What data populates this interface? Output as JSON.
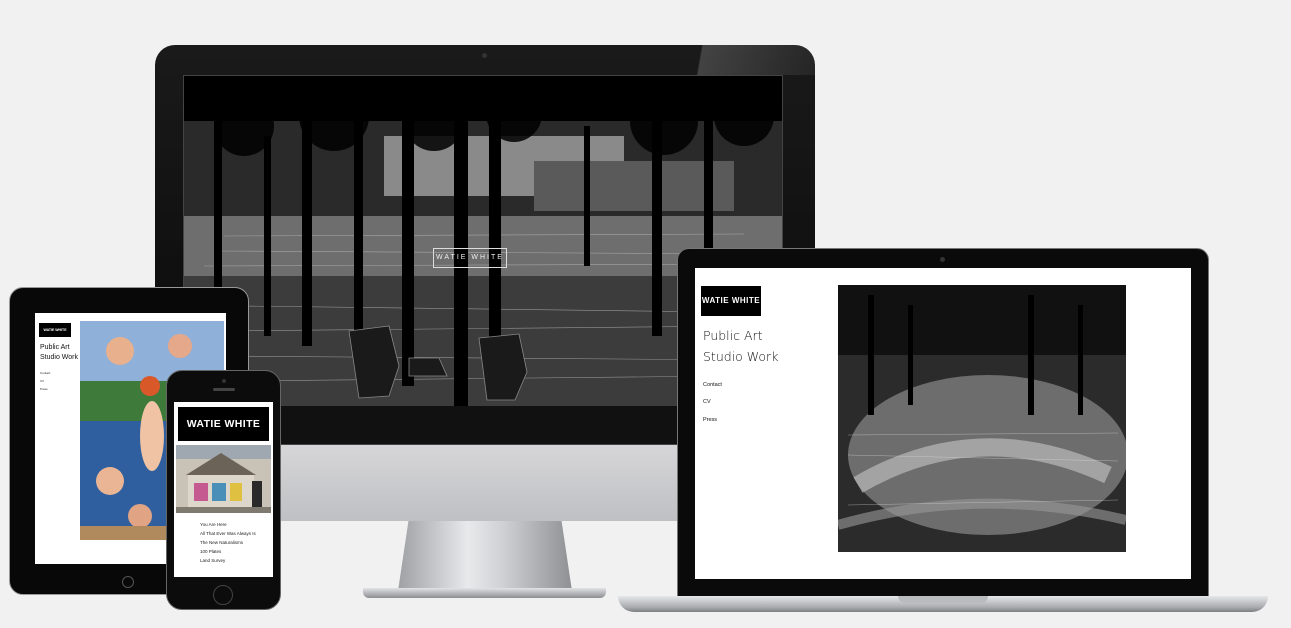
{
  "site": {
    "logo": "WATIE WHITE",
    "hero_logo": "WATIE WHITE"
  },
  "laptop": {
    "nav_primary": [
      "Public Art",
      "Studio Work"
    ],
    "nav_secondary": [
      "Contact",
      "CV",
      "Press"
    ]
  },
  "ipad": {
    "logo": "WATIE WHITE",
    "nav_primary": [
      "Public Art",
      "Studio Work"
    ],
    "nav_secondary": [
      "Contact",
      "CV",
      "Press"
    ]
  },
  "iphone": {
    "logo": "WATIE WHITE",
    "list": [
      "You Are Here",
      "All That Ever Was Always Is",
      "The New Naturalisms",
      "100 Plates",
      "Land Survey"
    ]
  },
  "colors": {
    "background": "#f1f1f1",
    "bezel": "#0a0a0a",
    "aluminum": "#c8c9cc"
  },
  "icons": {
    "imac_logo": "apple-logo-icon"
  }
}
